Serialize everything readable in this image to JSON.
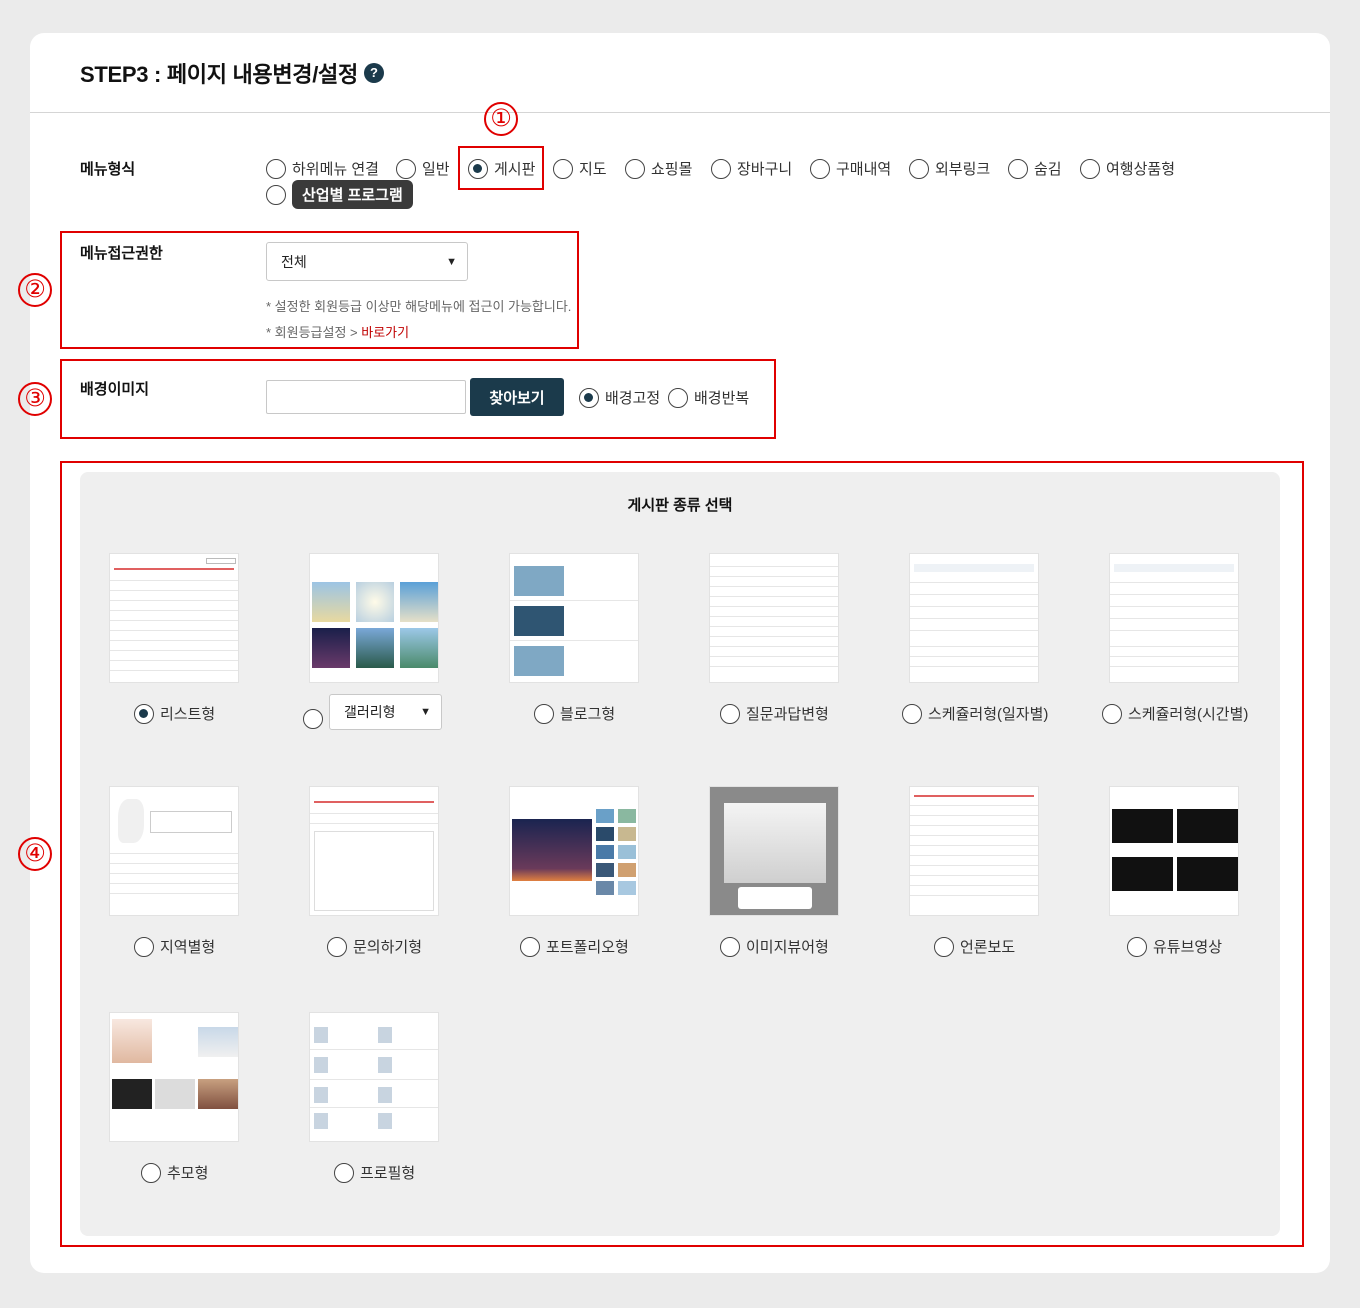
{
  "header": {
    "title": "STEP3 : 페이지 내용변경/설정",
    "help_icon": "?"
  },
  "menu_type": {
    "label": "메뉴형식",
    "options": [
      {
        "label": "하위메뉴 연결",
        "checked": false
      },
      {
        "label": "일반",
        "checked": false
      },
      {
        "label": "게시판",
        "checked": true
      },
      {
        "label": "지도",
        "checked": false
      },
      {
        "label": "쇼핑몰",
        "checked": false
      },
      {
        "label": "장바구니",
        "checked": false
      },
      {
        "label": "구매내역",
        "checked": false
      },
      {
        "label": "외부링크",
        "checked": false
      },
      {
        "label": "숨김",
        "checked": false
      },
      {
        "label": "여행상품형",
        "checked": false
      },
      {
        "label": "산업별 프로그램",
        "checked": false
      }
    ]
  },
  "access": {
    "label": "메뉴접근권한",
    "selected": "전체",
    "note1": "* 설정한 회원등급 이상만 해당메뉴에 접근이 가능합니다.",
    "note2_prefix": "* 회원등급설정 > ",
    "note2_link": "바로가기"
  },
  "background": {
    "label": "배경이미지",
    "input_value": "",
    "browse_label": "찾아보기",
    "fixed_label": "배경고정",
    "repeat_label": "배경반복",
    "fixed_checked": true
  },
  "board": {
    "title": "게시판 종류 선택",
    "gallery_select": "갤러리형",
    "types": [
      {
        "label": "리스트형",
        "checked": true
      },
      {
        "label": "갤러리형",
        "checked": false
      },
      {
        "label": "블로그형",
        "checked": false
      },
      {
        "label": "질문과답변형",
        "checked": false
      },
      {
        "label": "스케쥴러형(일자별)",
        "checked": false
      },
      {
        "label": "스케쥴러형(시간별)",
        "checked": false
      },
      {
        "label": "지역별형",
        "checked": false
      },
      {
        "label": "문의하기형",
        "checked": false
      },
      {
        "label": "포트폴리오형",
        "checked": false
      },
      {
        "label": "이미지뷰어형",
        "checked": false
      },
      {
        "label": "언론보도",
        "checked": false
      },
      {
        "label": "유튜브영상",
        "checked": false
      },
      {
        "label": "추모형",
        "checked": false
      },
      {
        "label": "프로필형",
        "checked": false
      }
    ]
  },
  "annotations": [
    "①",
    "②",
    "③",
    "④"
  ],
  "colors": {
    "accent": "#1b3a4b",
    "annotation": "#e00000",
    "link": "#c00000"
  }
}
